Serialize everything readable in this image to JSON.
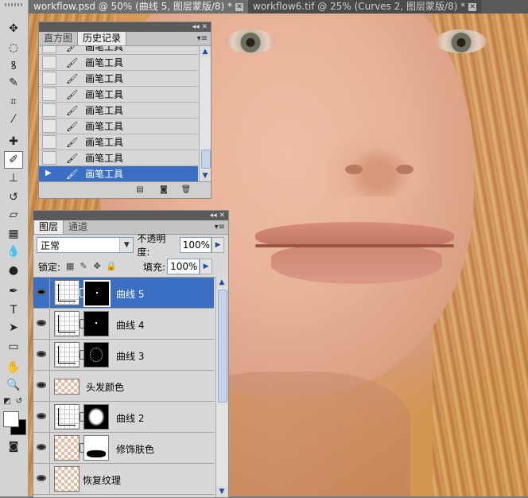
{
  "tabs": [
    {
      "label": "workflow.psd @ 50% (曲线 5, 图层蒙版/8) *"
    },
    {
      "label": "workflow6.tif @ 25% (Curves 2, 图层蒙版/8) *"
    }
  ],
  "tools": [
    {
      "icon": "move-icon",
      "glyph": "✥"
    },
    {
      "icon": "marquee-icon",
      "glyph": "◌"
    },
    {
      "icon": "lasso-icon",
      "glyph": "ꝸ"
    },
    {
      "icon": "quick-selection-icon",
      "glyph": "✎"
    },
    {
      "icon": "crop-icon",
      "glyph": "⌗"
    },
    {
      "icon": "eyedropper-icon",
      "glyph": "⁄"
    },
    {
      "icon": "healing-brush-icon",
      "glyph": "✚"
    },
    {
      "icon": "brush-icon",
      "glyph": "✐"
    },
    {
      "icon": "clone-stamp-icon",
      "glyph": "⊥"
    },
    {
      "icon": "history-brush-icon",
      "glyph": "↺"
    },
    {
      "icon": "eraser-icon",
      "glyph": "▱"
    },
    {
      "icon": "gradient-icon",
      "glyph": "▦"
    },
    {
      "icon": "blur-icon",
      "glyph": "💧"
    },
    {
      "icon": "dodge-icon",
      "glyph": "●"
    },
    {
      "icon": "pen-icon",
      "glyph": "✒"
    },
    {
      "icon": "type-icon",
      "glyph": "T"
    },
    {
      "icon": "path-selection-icon",
      "glyph": "➤"
    },
    {
      "icon": "shape-icon",
      "glyph": "▭"
    },
    {
      "icon": "hand-icon",
      "glyph": "✋"
    },
    {
      "icon": "zoom-icon",
      "glyph": "🔍"
    }
  ],
  "history_panel": {
    "tabs": [
      "直方图",
      "历史记录"
    ],
    "items": [
      "画笔工具",
      "画笔工具",
      "画笔工具",
      "画笔工具",
      "画笔工具",
      "画笔工具",
      "画笔工具",
      "画笔工具",
      "画笔工具"
    ],
    "selected_index": 8
  },
  "layers_panel": {
    "tabs": [
      "图层",
      "通道"
    ],
    "blend_mode": "正常",
    "opacity_label": "不透明度:",
    "opacity_value": "100%",
    "lock_label": "锁定:",
    "fill_label": "填充:",
    "fill_value": "100%",
    "layers": [
      {
        "name": "曲线 5",
        "type": "curves",
        "mask": "dot",
        "selected": true
      },
      {
        "name": "曲线 4",
        "type": "curves",
        "mask": "dot",
        "selected": false
      },
      {
        "name": "曲线 3",
        "type": "curves",
        "mask": "ring",
        "selected": false
      },
      {
        "name": "头发颜色",
        "type": "pixel-hair",
        "mask": "none",
        "selected": false
      },
      {
        "name": "曲线 2",
        "type": "curves",
        "mask": "blob",
        "selected": false
      },
      {
        "name": "修饰肤色",
        "type": "pixel",
        "mask": "skin",
        "selected": false
      },
      {
        "name": "恢复纹理",
        "type": "pixel",
        "mask": "none",
        "selected": false
      }
    ]
  },
  "colors": {
    "selection_blue": "#3a6fc4",
    "foreground": "#ffffff",
    "background": "#000000"
  }
}
